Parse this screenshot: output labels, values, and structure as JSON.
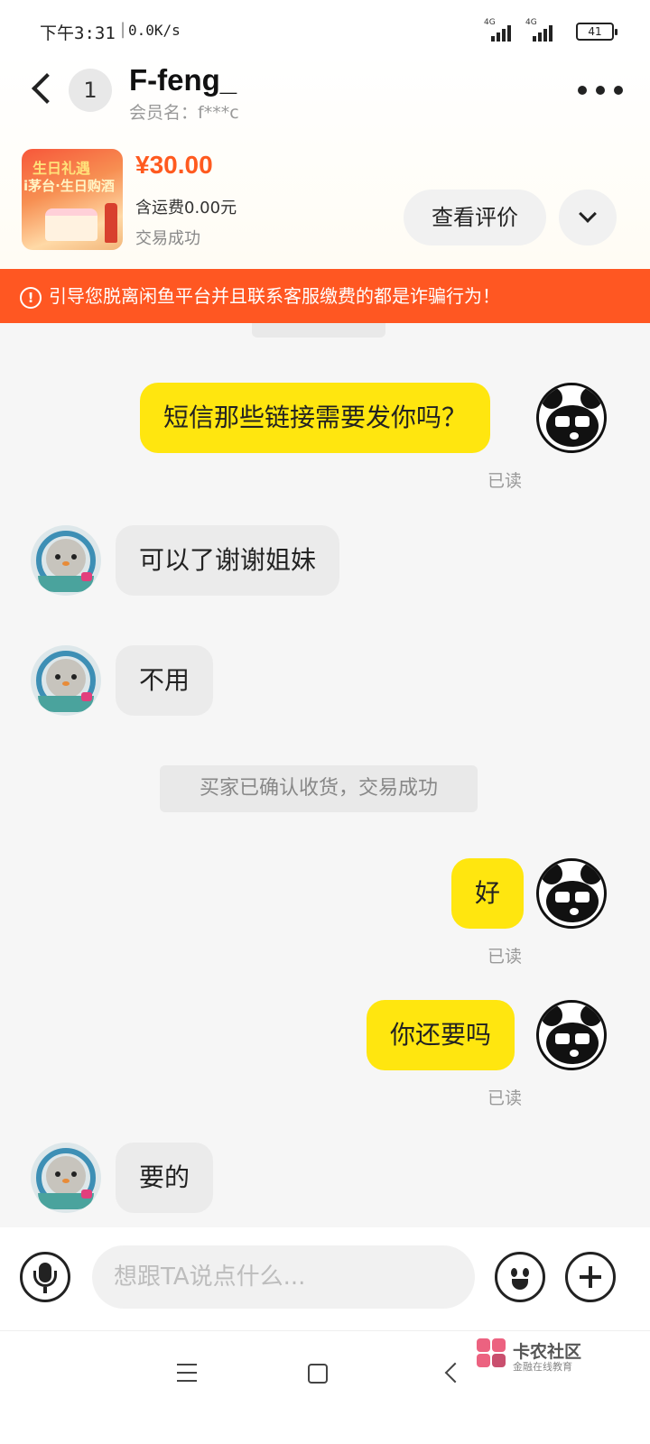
{
  "status_bar": {
    "time": "下午3:31",
    "separator": "|",
    "net_speed": "0.0K/s",
    "signal_1_label": "4G",
    "signal_2_label": "4G",
    "battery": "41"
  },
  "header": {
    "unread_count": "1",
    "contact_name": "F-feng_",
    "member_name": "会员名：f***c"
  },
  "product": {
    "thumb_title": "生日礼遇",
    "thumb_subtitle": "i茅台·生日购酒",
    "price": "¥30.00",
    "shipping": "含运费0.00元",
    "status": "交易成功",
    "review_button": "查看评价"
  },
  "warning": {
    "icon": "!",
    "text": "引导您脱离闲鱼平台并且联系客服缴费的都是诈骗行为！"
  },
  "messages": [
    {
      "side": "out",
      "text": "短信那些链接需要发你吗？",
      "status": "已读"
    },
    {
      "side": "in",
      "text": "可以了谢谢姐妹"
    },
    {
      "side": "in",
      "text": "不用"
    },
    {
      "side": "system",
      "text": "买家已确认收货，交易成功"
    },
    {
      "side": "out",
      "text": "好",
      "status": "已读"
    },
    {
      "side": "out",
      "text": "你还要吗",
      "status": "已读"
    },
    {
      "side": "in",
      "text": "要的"
    }
  ],
  "input": {
    "placeholder": "想跟TA说点什么..."
  },
  "watermark": {
    "name": "卡农社区",
    "sub": "金融在线教育"
  },
  "icons": {
    "back": "back-chevron-icon",
    "more": "more-dots-icon",
    "expand": "chevron-down-icon",
    "voice": "microphone-icon",
    "emoji": "smiley-icon",
    "plus": "plus-icon"
  },
  "colors": {
    "accent_yellow": "#ffe60f",
    "price_orange": "#ff5a1f",
    "warning_bg": "#ff5722",
    "incoming_bubble": "#ebebeb"
  }
}
